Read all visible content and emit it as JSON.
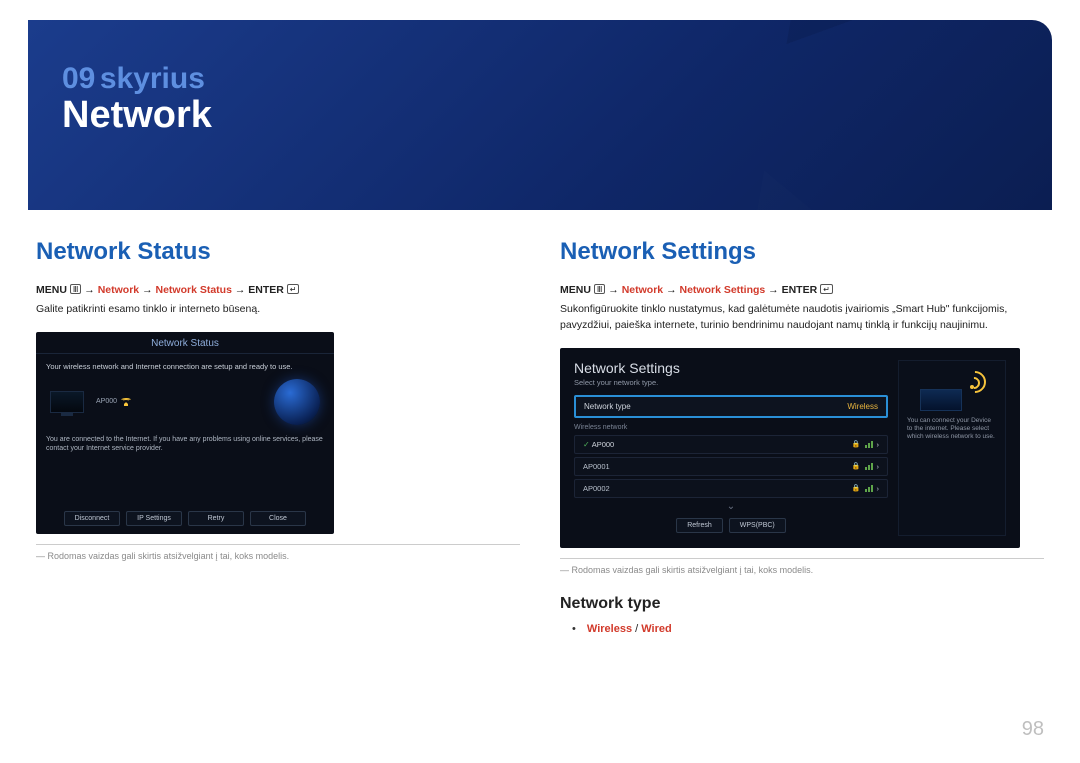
{
  "header": {
    "chapter_num": "09",
    "chapter_word": "skyrius",
    "section_title": "Network"
  },
  "left": {
    "heading": "Network Status",
    "breadcrumb": {
      "menu": "MENU",
      "path1": "Network",
      "path2": "Network Status",
      "enter": "ENTER"
    },
    "desc": "Galite patikrinti esamo tinklo ir interneto būseną.",
    "screenshot": {
      "title": "Network Status",
      "line1": "Your wireless network and Internet connection are setup and ready to use.",
      "ap_label": "AP000",
      "line2": "You are connected to the Internet. If you have any problems using online services, please contact your Internet service provider.",
      "buttons": [
        "Disconnect",
        "IP Settings",
        "Retry",
        "Close"
      ]
    },
    "footnote": "Rodomas vaizdas gali skirtis atsižvelgiant į tai, koks modelis."
  },
  "right": {
    "heading": "Network Settings",
    "breadcrumb": {
      "menu": "MENU",
      "path1": "Network",
      "path2": "Network Settings",
      "enter": "ENTER"
    },
    "desc": "Sukonfigūruokite tinklo nustatymus, kad galėtumėte naudotis įvairiomis „Smart Hub\" funkcijomis, pavyzdžiui, paieška internete, turinio bendrinimu naudojant namų tinklą ir funkcijų naujinimu.",
    "screenshot": {
      "title": "Network Settings",
      "subtitle": "Select your network type.",
      "network_type_label": "Network type",
      "network_type_value": "Wireless",
      "wireless_label": "Wireless network",
      "aps": [
        "AP000",
        "AP0001",
        "AP0002"
      ],
      "buttons": [
        "Refresh",
        "WPS(PBC)"
      ],
      "side_text": "You can connect your Device to the internet. Please select which wireless network to use."
    },
    "footnote": "Rodomas vaizdas gali skirtis atsižvelgiant į tai, koks modelis.",
    "subheading": "Network type",
    "bullet": {
      "a": "Wireless",
      "sep": " / ",
      "b": "Wired"
    }
  },
  "page_number": "98",
  "arrow": "→",
  "dash": "―",
  "lock": "🔒",
  "chev": "›"
}
